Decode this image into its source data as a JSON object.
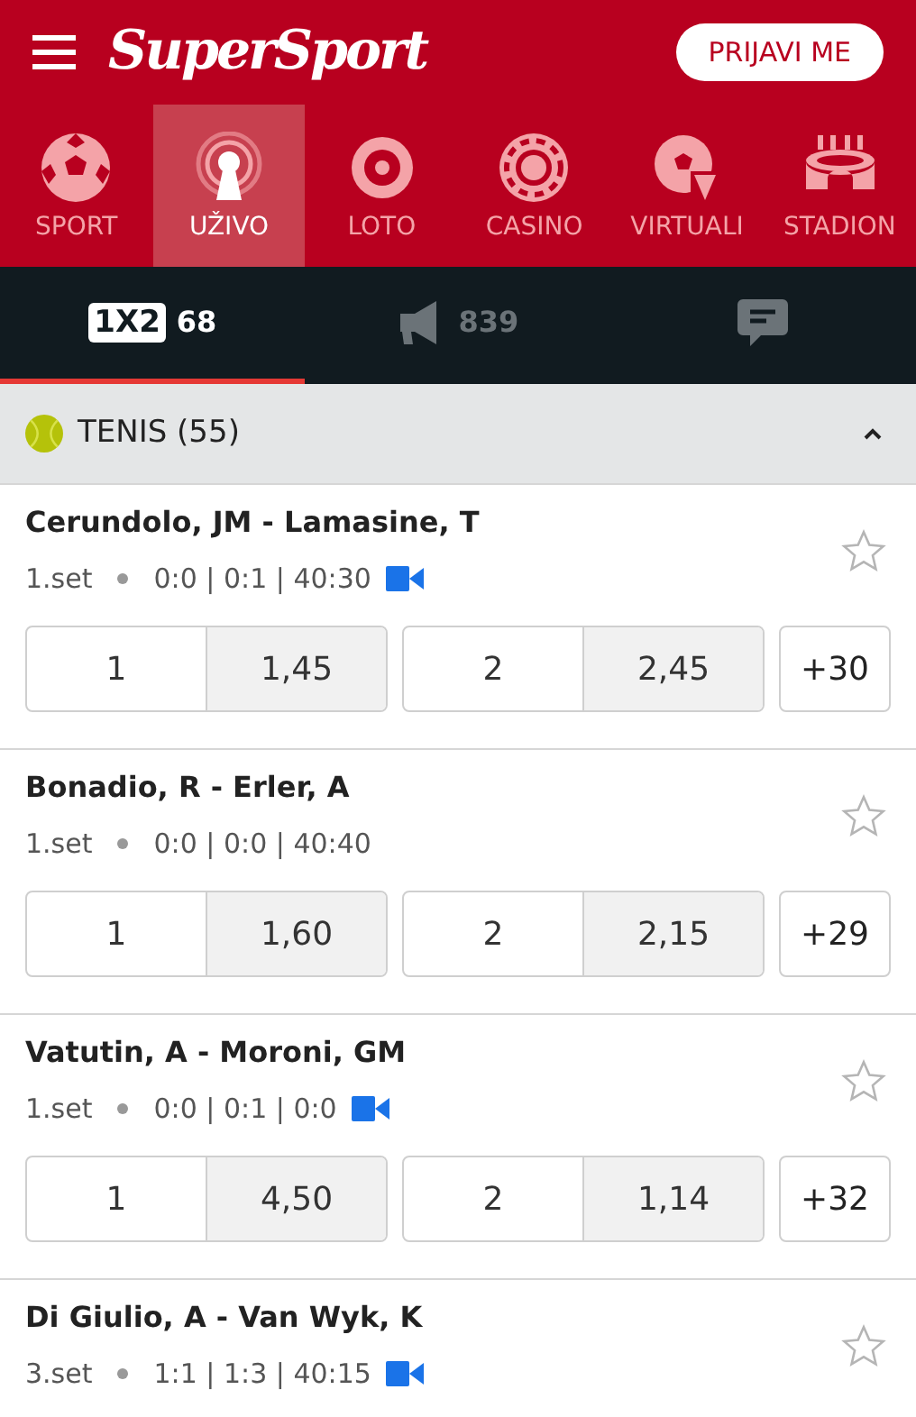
{
  "header": {
    "logo": "SuperSport",
    "login_button": "PRIJAVI ME"
  },
  "nav": [
    {
      "kind": "ball",
      "label": "SPORT",
      "selected": false
    },
    {
      "kind": "live",
      "label": "UŽIVO",
      "selected": true
    },
    {
      "kind": "lotto",
      "label": "LOTO",
      "selected": false
    },
    {
      "kind": "chip",
      "label": "CASINO",
      "selected": false
    },
    {
      "kind": "virtual",
      "label": "VIRTUALI",
      "selected": false
    },
    {
      "kind": "stadium",
      "label": "STADION",
      "selected": false
    }
  ],
  "tabs": [
    {
      "kind": "badge",
      "badge": "1X2",
      "count": "68",
      "selected": true
    },
    {
      "kind": "megaphone",
      "count": "839",
      "selected": false
    },
    {
      "kind": "chat",
      "selected": false
    }
  ],
  "section": {
    "title": "TENIS (55)",
    "expanded": true
  },
  "matches": [
    {
      "name": "Cerundolo, JM - Lamasine, T",
      "period": "1.set",
      "score": "0:0 | 0:1 | 40:30",
      "video": true,
      "odds": [
        {
          "label": "1",
          "value": "1,45"
        },
        {
          "label": "2",
          "value": "2,45"
        }
      ],
      "more": "+30"
    },
    {
      "name": "Bonadio, R - Erler, A",
      "period": "1.set",
      "score": "0:0 | 0:0 | 40:40",
      "video": false,
      "odds": [
        {
          "label": "1",
          "value": "1,60"
        },
        {
          "label": "2",
          "value": "2,15"
        }
      ],
      "more": "+29"
    },
    {
      "name": "Vatutin, A - Moroni, GM",
      "period": "1.set",
      "score": "0:0 | 0:1 | 0:0",
      "video": true,
      "odds": [
        {
          "label": "1",
          "value": "4,50"
        },
        {
          "label": "2",
          "value": "1,14"
        }
      ],
      "more": "+32"
    },
    {
      "name": "Di Giulio, A - Van Wyk, K",
      "period": "3.set",
      "score": "1:1 | 1:3 | 40:15",
      "video": true
    }
  ]
}
